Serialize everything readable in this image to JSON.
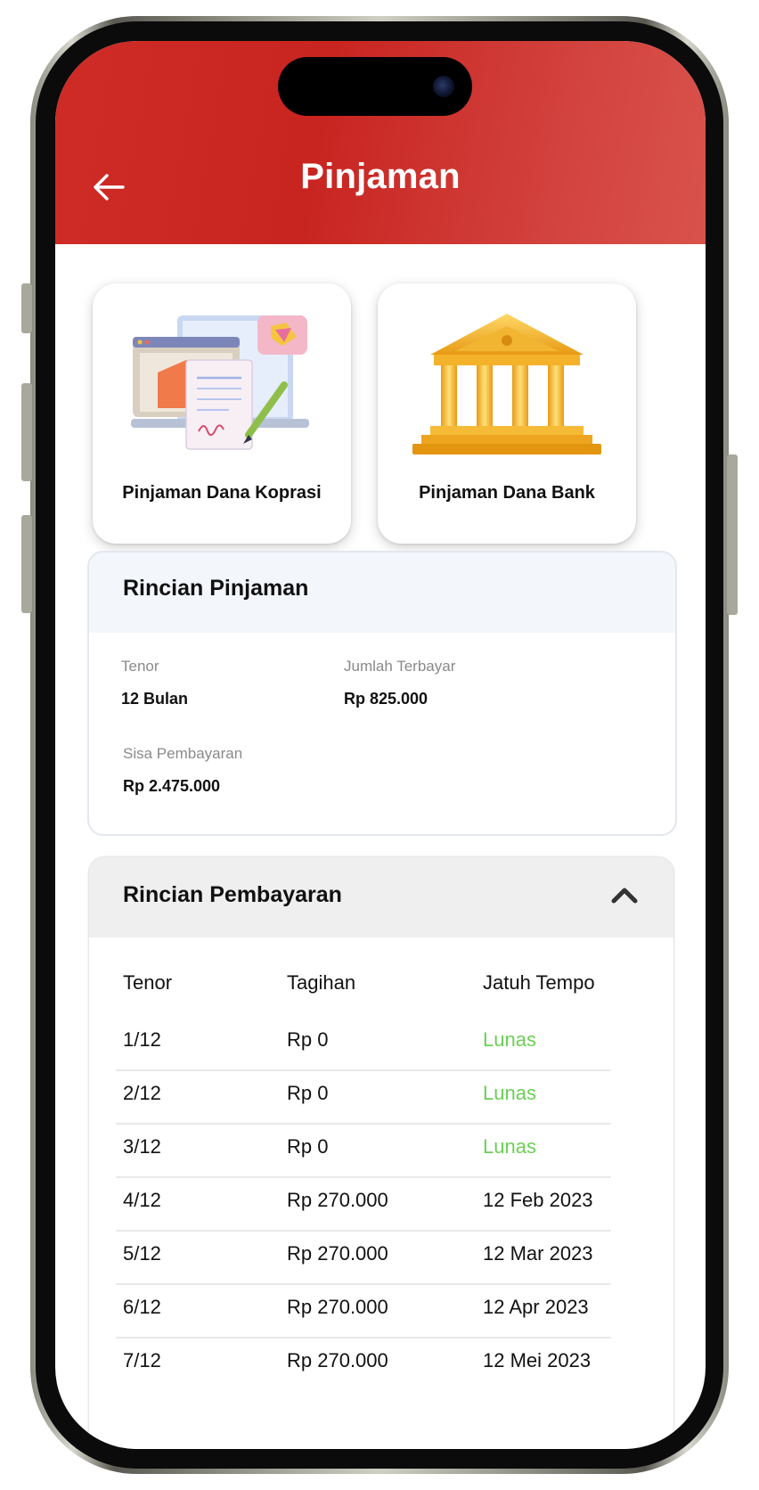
{
  "header": {
    "title": "Pinjaman",
    "back_icon": "arrow-left-icon"
  },
  "options": [
    {
      "label": "Pinjaman Dana Koprasi",
      "icon": "document-sign-icon"
    },
    {
      "label": "Pinjaman Dana Bank",
      "icon": "bank-building-icon"
    }
  ],
  "loan_details": {
    "title": "Rincian Pinjaman",
    "tenor_label": "Tenor",
    "tenor_value": "12 Bulan",
    "paid_label": "Jumlah Terbayar",
    "paid_value": "Rp 825.000",
    "remaining_label": "Sisa Pembayaran",
    "remaining_value": "Rp 2.475.000"
  },
  "payment_details": {
    "title": "Rincian Pembayaran",
    "toggle_icon": "chevron-up-icon",
    "columns": [
      "Tenor",
      "Tagihan",
      "Jatuh Tempo"
    ],
    "rows": [
      {
        "tenor": "1/12",
        "bill": "Rp 0",
        "due": "Lunas",
        "paid": true
      },
      {
        "tenor": "2/12",
        "bill": "Rp 0",
        "due": "Lunas",
        "paid": true
      },
      {
        "tenor": "3/12",
        "bill": "Rp 0",
        "due": "Lunas",
        "paid": true
      },
      {
        "tenor": "4/12",
        "bill": "Rp 270.000",
        "due": "12 Feb 2023",
        "paid": false
      },
      {
        "tenor": "5/12",
        "bill": "Rp 270.000",
        "due": "12 Mar 2023",
        "paid": false
      },
      {
        "tenor": "6/12",
        "bill": "Rp 270.000",
        "due": "12 Apr 2023",
        "paid": false
      },
      {
        "tenor": "7/12",
        "bill": "Rp 270.000",
        "due": "12 Mei 2023",
        "paid": false
      }
    ]
  },
  "colors": {
    "header_red": "#c82420",
    "paid_green": "#6ccf57"
  }
}
